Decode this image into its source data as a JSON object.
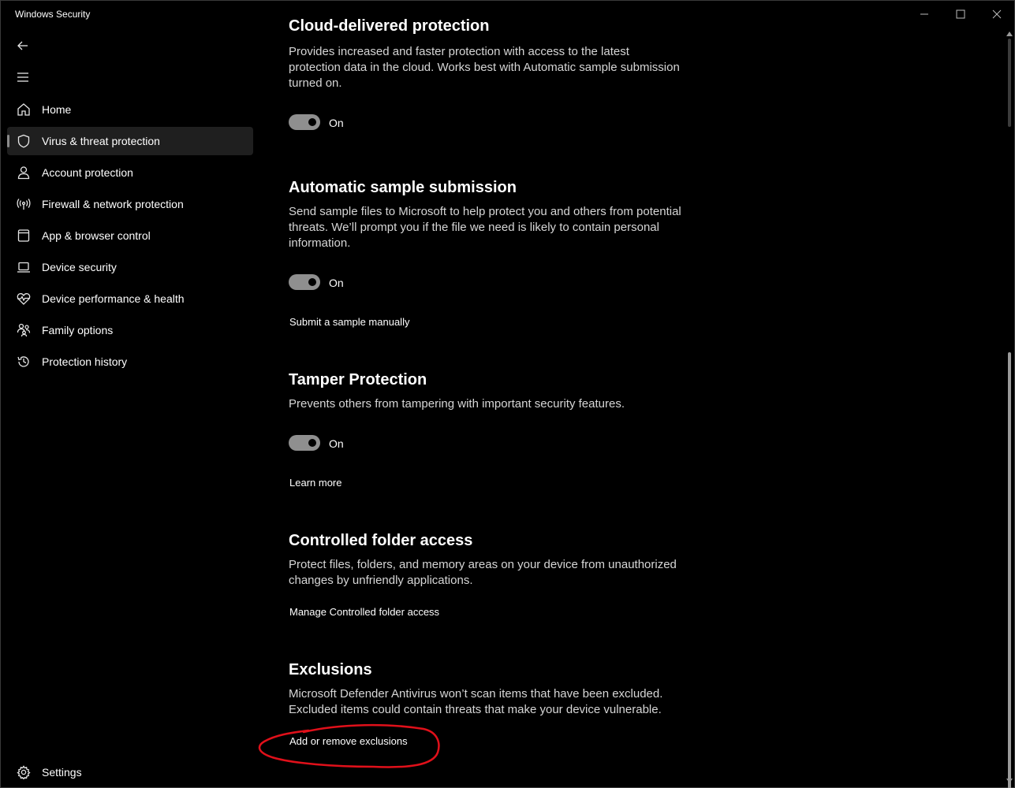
{
  "window": {
    "title": "Windows Security"
  },
  "sidebar": {
    "items": [
      {
        "label": "Home",
        "icon": "home-icon"
      },
      {
        "label": "Virus & threat protection",
        "icon": "shield-icon",
        "selected": true
      },
      {
        "label": "Account protection",
        "icon": "person-icon"
      },
      {
        "label": "Firewall & network protection",
        "icon": "antenna-icon"
      },
      {
        "label": "App & browser control",
        "icon": "app-window-icon"
      },
      {
        "label": "Device security",
        "icon": "laptop-icon"
      },
      {
        "label": "Device performance & health",
        "icon": "heart-pulse-icon"
      },
      {
        "label": "Family options",
        "icon": "family-icon"
      },
      {
        "label": "Protection history",
        "icon": "history-icon"
      }
    ],
    "settings_label": "Settings"
  },
  "main": {
    "cloud": {
      "title": "Cloud-delivered protection",
      "description": "Provides increased and faster protection with access to the latest protection data in the cloud. Works best with Automatic sample submission turned on.",
      "toggle_label": "On",
      "toggle_on": true
    },
    "sample": {
      "title": "Automatic sample submission",
      "description": "Send sample files to Microsoft to help protect you and others from potential threats. We’ll prompt you if the file we need is likely to contain personal information.",
      "toggle_label": "On",
      "toggle_on": true,
      "link": "Submit a sample manually"
    },
    "tamper": {
      "title": "Tamper Protection",
      "description": "Prevents others from tampering with important security features.",
      "toggle_label": "On",
      "toggle_on": true,
      "link": "Learn more"
    },
    "folder": {
      "title": "Controlled folder access",
      "description": "Protect files, folders, and memory areas on your device from unauthorized changes by unfriendly applications.",
      "link": "Manage Controlled folder access"
    },
    "exclusions": {
      "title": "Exclusions",
      "description": "Microsoft Defender Antivirus won’t scan items that have been excluded. Excluded items could contain threats that make your device vulnerable.",
      "link": "Add or remove exclusions"
    }
  },
  "colors": {
    "background": "#000000",
    "toggle_track": "#8f8f8f",
    "annotation_circle": "#e0101a"
  }
}
